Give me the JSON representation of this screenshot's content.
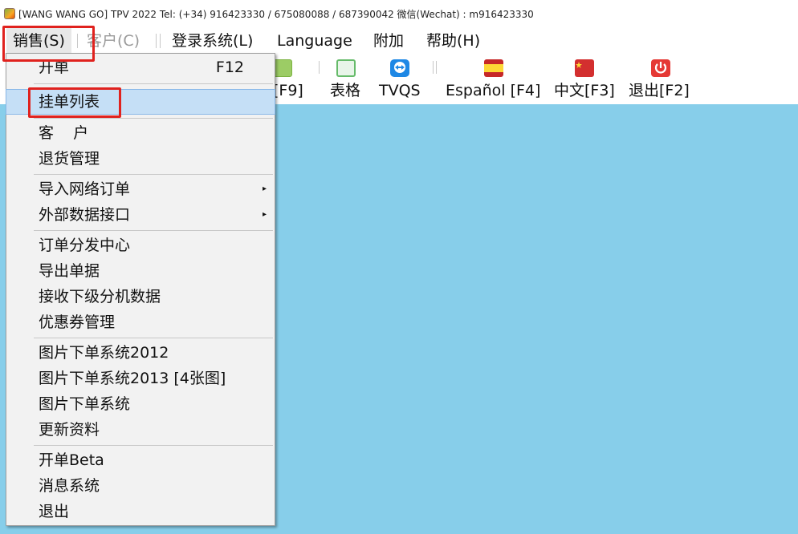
{
  "window": {
    "title": "[WANG WANG GO]   TPV 2022   Tel:  (+34) 916423330 / 675080088 / 687390042    微信(Wechat) :  m916423330"
  },
  "menubar": {
    "sales": "销售(S)",
    "customer": "客户(C)",
    "login": "登录系统(L)",
    "language": "Language",
    "addon": "附加",
    "help": "帮助(H)"
  },
  "toolbar": {
    "partial_label": "[F9]",
    "table_label": "表格",
    "tvqs_label": "TVQS",
    "espanol_label": "Español [F4]",
    "chinese_label": "中文[F3]",
    "exit_label": "退出[F2]"
  },
  "dropdown": {
    "open_order": {
      "label": "开单",
      "shortcut": "F12"
    },
    "pending_list": "挂单列表",
    "customer": "客    户",
    "returns": "退货管理",
    "import_online": "导入网络订单",
    "external_api": "外部数据接口",
    "dispatch_center": "订单分发中心",
    "export_docs": "导出单据",
    "receive_sub": "接收下级分机数据",
    "coupons": "优惠券管理",
    "pic_order_2012": "图片下单系统2012",
    "pic_order_2013": "图片下单系统2013 [4张图]",
    "pic_order": "图片下单系统",
    "update_data": "更新资料",
    "open_beta": "开单Beta",
    "messages": "消息系统",
    "exit": "退出"
  },
  "colors": {
    "content_bg": "#87ceea",
    "highlight_box": "#e0221e",
    "menu_highlight": "#c5dff6"
  }
}
